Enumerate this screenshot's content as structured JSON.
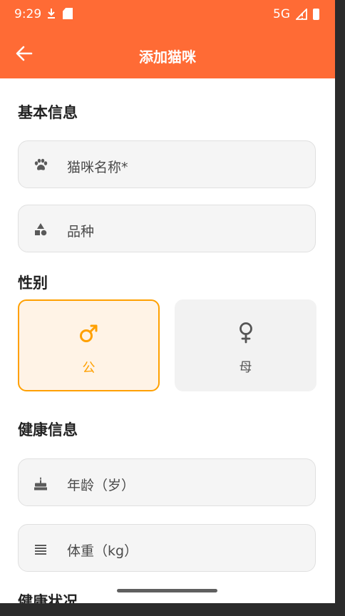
{
  "status_bar": {
    "time": "9:29",
    "network": "5G"
  },
  "app_bar": {
    "title": "添加猫咪"
  },
  "sections": {
    "basic_info": "基本信息",
    "gender": "性别",
    "health_info": "健康信息",
    "health_status": "健康状况"
  },
  "fields": {
    "name": {
      "placeholder": "猫咪名称*",
      "icon": "paw-icon"
    },
    "breed": {
      "placeholder": "品种",
      "icon": "category-icon"
    },
    "age": {
      "placeholder": "年龄（岁）",
      "icon": "cake-icon"
    },
    "weight": {
      "placeholder": "体重（kg）",
      "icon": "weight-lines-icon"
    }
  },
  "gender_options": {
    "male": {
      "label": "公",
      "selected": true,
      "icon": "male-icon"
    },
    "female": {
      "label": "母",
      "selected": false,
      "icon": "female-icon"
    }
  },
  "colors": {
    "primary": "#FF6B35",
    "selected_accent": "#FFA000",
    "selected_bg": "#FFF3E6",
    "field_bg": "#F5F5F5"
  }
}
